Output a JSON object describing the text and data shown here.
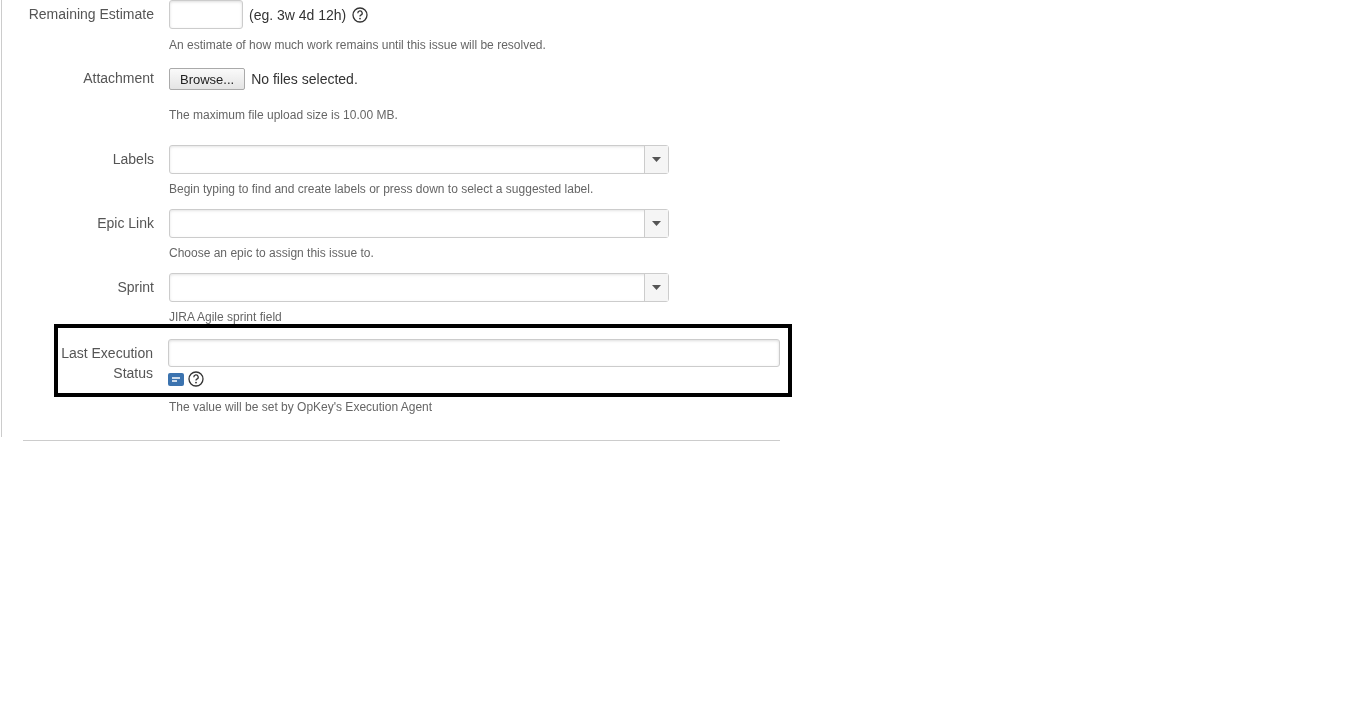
{
  "fields": [
    {
      "kind": "estimate",
      "label": "Remaining Estimate",
      "hint": "(eg. 3w 4d 12h)",
      "help": "An estimate of how much work remains until this issue will be resolved.",
      "highlighted": false
    },
    {
      "kind": "file",
      "label": "Attachment",
      "button": "Browse...",
      "status": "No files selected.",
      "help": "The maximum file upload size is 10.00 MB.",
      "highlighted": false
    },
    {
      "kind": "select",
      "label": "Labels",
      "help": "Begin typing to find and create labels or press down to select a suggested label.",
      "highlighted": false
    },
    {
      "kind": "select",
      "label": "Epic Link",
      "help": "Choose an epic to assign this issue to.",
      "highlighted": false
    },
    {
      "kind": "select",
      "label": "Sprint",
      "help": "JIRA Agile sprint field",
      "highlighted": false
    },
    {
      "kind": "text",
      "label": "Last Execution Status",
      "help": "The value will be set by OpKey's Execution Agent",
      "highlighted": true
    }
  ]
}
